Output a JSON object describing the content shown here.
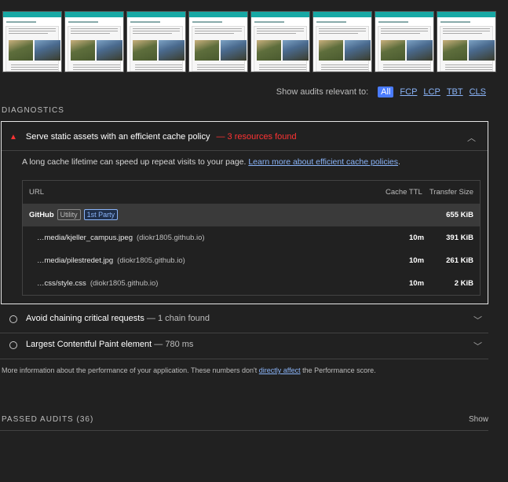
{
  "filmstrip": {
    "frame_count": 8
  },
  "relevant": {
    "label": "Show audits relevant to:",
    "metrics": [
      "All",
      "FCP",
      "LCP",
      "TBT",
      "CLS"
    ],
    "active": "All",
    "active_color": "#4a7cff"
  },
  "diagnostics": {
    "heading": "DIAGNOSTICS",
    "cache_audit": {
      "title": "Serve static assets with an efficient cache policy",
      "display_value": "— 3 resources found",
      "status_icon": "warning-triangle-icon",
      "status_color": "#ff3333",
      "description": "A long cache lifetime can speed up repeat visits to your page. ",
      "learn_more": "Learn more about efficient cache policies",
      "description_end": ".",
      "table": {
        "headers": {
          "url": "URL",
          "ttl": "Cache TTL",
          "size": "Transfer Size"
        },
        "group": {
          "entity": "GitHub",
          "badge1": "Utility",
          "badge2": "1st Party",
          "size": "655 KiB"
        },
        "rows": [
          {
            "url": "…media/kjeller_campus.jpeg",
            "host": "(diokr1805.github.io)",
            "ttl": "10m",
            "size": "391 KiB"
          },
          {
            "url": "…media/pilestredet.jpg",
            "host": "(diokr1805.github.io)",
            "ttl": "10m",
            "size": "261 KiB"
          },
          {
            "url": "…css/style.css",
            "host": "(diokr1805.github.io)",
            "ttl": "10m",
            "size": "2 KiB"
          }
        ]
      }
    },
    "collapsed_audits": [
      {
        "title": "Avoid chaining critical requests",
        "display_value": " — 1 chain found"
      },
      {
        "title": "Largest Contentful Paint element",
        "display_value": " — 780 ms"
      }
    ]
  },
  "footer_note": {
    "before": "More information about the performance of your application. These numbers don't ",
    "link": "directly affect",
    "after": " the Performance score."
  },
  "passed": {
    "heading": "PASSED AUDITS (36)",
    "show": "Show"
  }
}
